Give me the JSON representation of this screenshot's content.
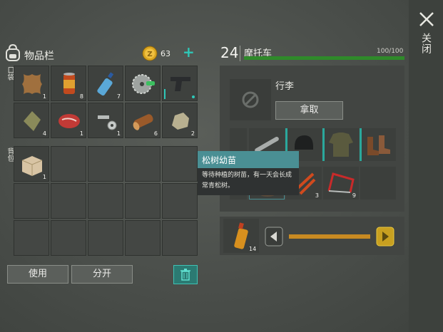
{
  "close": {
    "label": "关闭"
  },
  "inventory": {
    "title": "物品栏",
    "coins": "63",
    "add_coins": "+",
    "pocket_label": "口袋",
    "backpack_label": "背包",
    "pocket_slots": [
      {
        "icon": "leather-icon",
        "qty": "1"
      },
      {
        "icon": "canned-food-icon",
        "qty": "8"
      },
      {
        "icon": "water-bottle-icon",
        "qty": "7"
      },
      {
        "icon": "saw-blade-icon",
        "qty": ""
      },
      {
        "icon": "pistol-icon",
        "qty": ""
      },
      {
        "icon": "cloth-icon",
        "qty": "4"
      },
      {
        "icon": "raw-meat-icon",
        "qty": "1"
      },
      {
        "icon": "nuts-bolts-icon",
        "qty": "1"
      },
      {
        "icon": "wood-log-icon",
        "qty": "6"
      },
      {
        "icon": "stone-icon",
        "qty": "2"
      }
    ],
    "backpack_first": {
      "icon": "cardboard-box-icon",
      "qty": "1"
    }
  },
  "buttons": {
    "use": "使用",
    "split": "分开"
  },
  "vehicle": {
    "level": "24",
    "name": "摩托车",
    "capacity": "100/100",
    "luggage_label": "行李",
    "take_button": "拿取",
    "slots": [
      {
        "icon": "pipe-icon",
        "qty": ""
      },
      {
        "icon": "helmet-icon",
        "qty": ""
      },
      {
        "icon": "jacket-icon",
        "qty": ""
      },
      {
        "icon": "boots-icon",
        "qty": ""
      },
      {
        "icon": "seedling-icon",
        "qty": ""
      },
      {
        "icon": "bolt-cutter-icon",
        "qty": "3"
      },
      {
        "icon": "hacksaw-icon",
        "qty": "9"
      }
    ],
    "fuel_qty": "14"
  },
  "tooltip": {
    "title": "松树幼苗",
    "description": "等待种植的树苗，有一天会长成常青松树。"
  },
  "colors": {
    "accent": "#2ec8b8",
    "bar_green": "#2f8a2a",
    "tooltip_head": "#4a8f94"
  }
}
